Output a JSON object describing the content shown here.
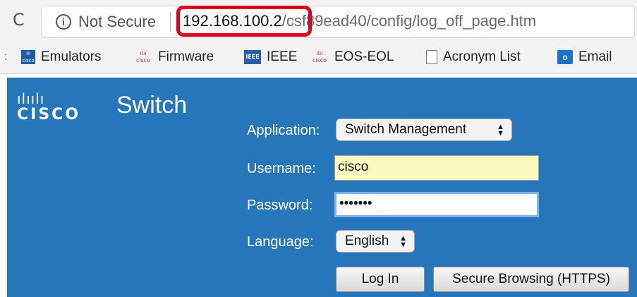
{
  "browser": {
    "reload_glyph": "C",
    "security_text": "Not Secure",
    "url_host": "192.168.100.2",
    "url_path": "/csf89ead40/config/log_off_page.htm",
    "highlight_color": "#e0001b"
  },
  "bookmarks": [
    {
      "icon": "cisco-square-icon",
      "label": "Emulators"
    },
    {
      "icon": "cisco-icon",
      "label": "Firmware"
    },
    {
      "icon": "ieee-icon",
      "label": "IEEE"
    },
    {
      "icon": "cisco-icon",
      "label": "EOS-EOL"
    },
    {
      "icon": "document-icon",
      "label": "Acronym List"
    },
    {
      "icon": "outlook-icon",
      "label": "Email"
    }
  ],
  "login": {
    "brand_bars": "ılıılı",
    "brand_word": "CISCO",
    "product": "Switch",
    "application_label": "Application:",
    "application_value": "Switch Management",
    "username_label": "Username:",
    "username_value": "cisco",
    "password_label": "Password:",
    "password_mask": "•••••••",
    "language_label": "Language:",
    "language_value": "English",
    "login_button": "Log In",
    "secure_button": "Secure Browsing (HTTPS)",
    "panel_color": "#2676bb"
  }
}
